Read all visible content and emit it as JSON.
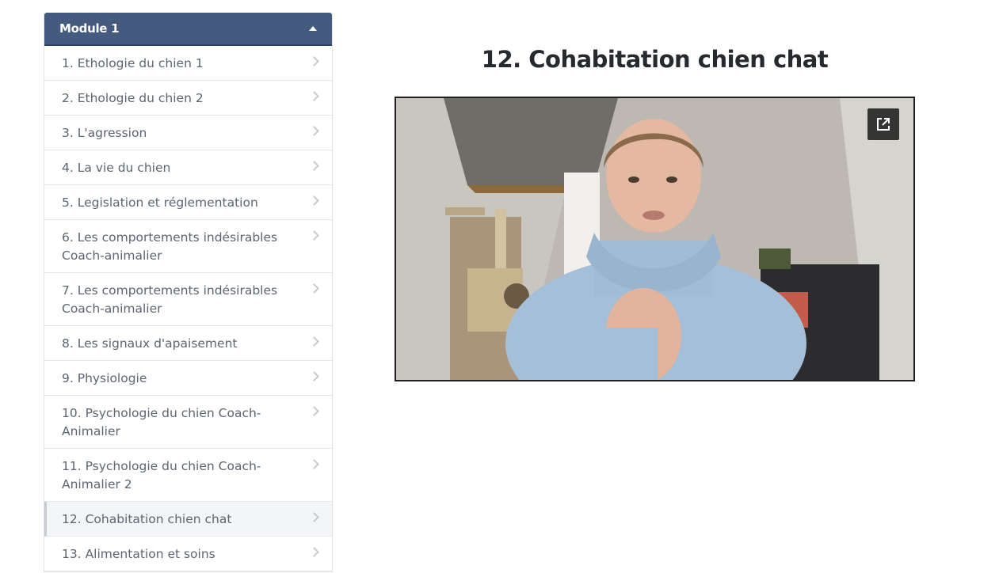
{
  "sidebar": {
    "module_title": "Module 1",
    "items": [
      {
        "label": "1. Ethologie du chien 1"
      },
      {
        "label": "2. Ethologie du chien 2"
      },
      {
        "label": "3. L'agression"
      },
      {
        "label": "4. La vie du chien"
      },
      {
        "label": "5. Legislation et réglementation"
      },
      {
        "label": "6. Les comportements indésirables Coach-animalier"
      },
      {
        "label": "7. Les comportements indésirables Coach-animalier"
      },
      {
        "label": "8. Les signaux d'apaisement"
      },
      {
        "label": "9. Physiologie"
      },
      {
        "label": "10. Psychologie du chien Coach-Animalier"
      },
      {
        "label": "11. Psychologie du chien Coach-Animalier 2"
      },
      {
        "label": "12. Cohabitation chien chat"
      },
      {
        "label": "13. Alimentation et soins"
      }
    ],
    "active_index": 11
  },
  "main": {
    "title": "12. Cohabitation chien chat",
    "video_popout_icon": "external-link-icon"
  },
  "colors": {
    "module_header": "#455a7f",
    "title": "#26292e",
    "item_text": "#5d6570"
  }
}
